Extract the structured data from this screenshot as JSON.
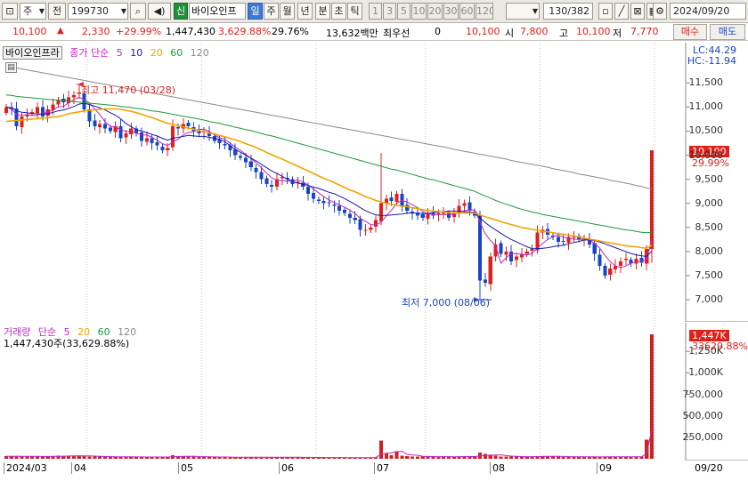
{
  "toolbar": {
    "market_label": "주",
    "prev_label": "전",
    "code_value": "199730",
    "new_badge": "신",
    "stock_name": "바이오인프",
    "periods": [
      "일",
      "주",
      "월",
      "년",
      "분",
      "초",
      "틱"
    ],
    "minute_options": [
      "1",
      "3",
      "5",
      "10",
      "20",
      "30",
      "60",
      "120"
    ],
    "count_value": "130/382",
    "date_value": "2024/09/20"
  },
  "quote": {
    "price": "10,100",
    "change": "2,330",
    "change_pct": "+29.99%",
    "volume": "1,447,430",
    "volume_ratio": "3,629.88%",
    "turnover": "29.76%",
    "amount": "13,632백만",
    "priority_label": "최우선",
    "priority_value": "0",
    "priority_price": "10,100",
    "open_label": "시",
    "open": "7,800",
    "high_label": "고",
    "high": "10,100",
    "low_label": "저",
    "low": "7,770",
    "buy_label": "매수",
    "sell_label": "매도"
  },
  "price_pane": {
    "name_label": "바이오인프라",
    "ma_title": "종가 단순",
    "ma_periods": [
      "5",
      "10",
      "20",
      "60",
      "120"
    ],
    "lc_label": "LC:44.29",
    "hc_label": "HC:-11.94",
    "high_note": "최고 11,470 (03/28)",
    "low_note": "최저 7,000 (08/06)",
    "last_price_tag": "10,100",
    "last_pct_tag": "29.99%"
  },
  "volume_pane": {
    "title": "거래량",
    "ma_title": "단순",
    "ma_periods": [
      "5",
      "20",
      "60",
      "120"
    ],
    "value_label": "1,447,430주(33,629.88%)",
    "last_tag": "1,447K",
    "last_pct_tag": "33629.88%"
  },
  "colors": {
    "up": "#e0201b",
    "down": "#1646c8",
    "ma5": "#c026c0",
    "ma10": "#1a1aa8",
    "ma20": "#f0a500",
    "ma60": "#1a9a3a",
    "ma120": "#8a8a8a",
    "volume": "#d02020"
  },
  "chart_data": [
    {
      "type": "candlestick",
      "title": "바이오인프라",
      "yaxis_ticks": [
        7000,
        7500,
        8000,
        8500,
        9000,
        9500,
        10000,
        10500,
        11000,
        11500
      ],
      "ylim": [
        6800,
        12150
      ],
      "xaxis_ticks": [
        "2024/03",
        "04",
        "05",
        "06",
        "07",
        "08",
        "09",
        "09/20"
      ],
      "series": [
        {
          "name": "close",
          "values": [
            11000,
            10950,
            10600,
            10800,
            10850,
            10900,
            11000,
            10800,
            10950,
            11050,
            11150,
            11100,
            11200,
            11250,
            11300,
            10950,
            10700,
            10600,
            10650,
            10550,
            10500,
            10600,
            10350,
            10450,
            10550,
            10450,
            10300,
            10350,
            10250,
            10200,
            10100,
            10150,
            10600,
            10550,
            10650,
            10600,
            10500,
            10450,
            10500,
            10400,
            10300,
            10250,
            10200,
            10100,
            10000,
            9950,
            9850,
            9750,
            9650,
            9500,
            9400,
            9350,
            9500,
            9550,
            9500,
            9400,
            9450,
            9350,
            9200,
            9100,
            9050,
            9000,
            9000,
            8950,
            8850,
            8800,
            8700,
            8650,
            8450,
            8450,
            8500,
            8650,
            9000,
            9100,
            9050,
            9200,
            8950,
            8850,
            8800,
            8750,
            8700,
            8800,
            8750,
            8800,
            8800,
            8700,
            8800,
            8950,
            9000,
            8850,
            8750,
            7400,
            7350,
            7900,
            8150,
            7950,
            8000,
            7800,
            7900,
            7950,
            8000,
            8050,
            8400,
            8450,
            8350,
            8300,
            8200,
            8200,
            8300,
            8300,
            8250,
            8250,
            8150,
            7950,
            7700,
            7500,
            7650,
            7700,
            7800,
            7850,
            7750,
            7850,
            7770,
            8050,
            10100
          ]
        },
        {
          "name": "5",
          "values": [
            11000,
            10960,
            10840,
            10830,
            10840,
            10820,
            10830,
            10870,
            10890,
            10940,
            11000,
            11010,
            11090,
            11150,
            11200,
            11160,
            11080,
            10960,
            10840,
            10690,
            10600,
            10580,
            10530,
            10490,
            10490,
            10460,
            10420,
            10420,
            10370,
            10310,
            10240,
            10200,
            10270,
            10330,
            10420,
            10470,
            10490,
            10530,
            10540,
            10490,
            10420,
            10360,
            10330,
            10250,
            10170,
            10100,
            10020,
            9930,
            9840,
            9740,
            9630,
            9530,
            9480,
            9470,
            9460,
            9470,
            9480,
            9450,
            9380,
            9300,
            9220,
            9140,
            9070,
            9020,
            8970,
            8920,
            8860,
            8790,
            8690,
            8630,
            8560,
            8550,
            8610,
            8740,
            8860,
            9000,
            9060,
            9030,
            8970,
            8910,
            8830,
            8780,
            8770,
            8770,
            8770,
            8770,
            8770,
            8810,
            8850,
            8860,
            8860,
            8610,
            8370,
            8230,
            8120,
            7760,
            7870,
            7960,
            7960,
            7940,
            7930,
            7960,
            8070,
            8170,
            8250,
            8310,
            8340,
            8300,
            8270,
            8260,
            8250,
            8260,
            8240,
            8170,
            8070,
            7920,
            7790,
            7700,
            7670,
            7700,
            7760,
            7790,
            7790,
            7840,
            8260
          ]
        },
        {
          "name": "10",
          "values": [
            11000,
            10980,
            10920,
            10890,
            10880,
            10860,
            10860,
            10850,
            10860,
            10890,
            10920,
            10940,
            10970,
            11010,
            11060,
            11080,
            11050,
            11020,
            10980,
            10940,
            10880,
            10830,
            10750,
            10660,
            10590,
            10530,
            10500,
            10470,
            10430,
            10400,
            10350,
            10310,
            10350,
            10370,
            10390,
            10410,
            10400,
            10390,
            10390,
            10370,
            10350,
            10330,
            10280,
            10200,
            10120,
            10060,
            10000,
            9940,
            9880,
            9810,
            9740,
            9670,
            9620,
            9560,
            9500,
            9450,
            9420,
            9400,
            9370,
            9340,
            9310,
            9270,
            9230,
            9200,
            9150,
            9100,
            9040,
            8980,
            8910,
            8850,
            8800,
            8760,
            8750,
            8750,
            8760,
            8770,
            8780,
            8800,
            8800,
            8800,
            8790,
            8790,
            8810,
            8820,
            8830,
            8840,
            8840,
            8840,
            8830,
            8820,
            8810,
            8700,
            8600,
            8520,
            8450,
            8380,
            8310,
            8250,
            8200,
            8150,
            8100,
            8060,
            8060,
            8070,
            8080,
            8100,
            8120,
            8130,
            8160,
            8190,
            8210,
            8240,
            8240,
            8230,
            8200,
            8160,
            8120,
            8080,
            8040,
            8000,
            7960,
            7930,
            7910,
            7900,
            8010
          ]
        },
        {
          "name": "20",
          "values": [
            10700,
            10710,
            10720,
            10730,
            10740,
            10750,
            10760,
            10770,
            10780,
            10790,
            10800,
            10830,
            10860,
            10880,
            10900,
            10920,
            10930,
            10940,
            10950,
            10960,
            10960,
            10960,
            10950,
            10930,
            10910,
            10880,
            10850,
            10810,
            10780,
            10740,
            10700,
            10660,
            10640,
            10610,
            10590,
            10560,
            10540,
            10510,
            10490,
            10460,
            10440,
            10410,
            10380,
            10350,
            10320,
            10280,
            10240,
            10200,
            10160,
            10110,
            10060,
            10010,
            9960,
            9920,
            9870,
            9820,
            9770,
            9720,
            9670,
            9620,
            9570,
            9520,
            9480,
            9430,
            9380,
            9330,
            9280,
            9240,
            9190,
            9140,
            9100,
            9060,
            9030,
            9000,
            8980,
            8960,
            8940,
            8930,
            8910,
            8890,
            8870,
            8850,
            8840,
            8830,
            8820,
            8810,
            8800,
            8800,
            8800,
            8800,
            8800,
            8760,
            8720,
            8690,
            8660,
            8620,
            8590,
            8560,
            8530,
            8500,
            8480,
            8460,
            8440,
            8420,
            8410,
            8390,
            8370,
            8360,
            8340,
            8320,
            8300,
            8280,
            8260,
            8240,
            8220,
            8200,
            8180,
            8160,
            8140,
            8120,
            8110,
            8100,
            8080,
            8070,
            8130
          ]
        },
        {
          "name": "60",
          "values": [
            11250,
            11240,
            11220,
            11210,
            11200,
            11190,
            11180,
            11170,
            11160,
            11150,
            11140,
            11130,
            11120,
            11110,
            11100,
            11090,
            11080,
            11070,
            11060,
            11050,
            11040,
            11030,
            11010,
            11000,
            10990,
            10970,
            10960,
            10940,
            10920,
            10910,
            10890,
            10870,
            10850,
            10830,
            10810,
            10790,
            10770,
            10750,
            10730,
            10700,
            10680,
            10660,
            10630,
            10610,
            10580,
            10560,
            10530,
            10510,
            10480,
            10450,
            10420,
            10400,
            10370,
            10340,
            10310,
            10280,
            10250,
            10220,
            10190,
            10160,
            10130,
            10100,
            10070,
            10040,
            10010,
            9980,
            9950,
            9920,
            9890,
            9860,
            9830,
            9800,
            9770,
            9740,
            9710,
            9690,
            9660,
            9630,
            9600,
            9570,
            9540,
            9510,
            9490,
            9460,
            9430,
            9400,
            9370,
            9340,
            9310,
            9280,
            9250,
            9200,
            9150,
            9110,
            9060,
            9020,
            8980,
            8950,
            8910,
            8880,
            8850,
            8820,
            8800,
            8770,
            8750,
            8730,
            8710,
            8690,
            8670,
            8650,
            8630,
            8610,
            8590,
            8570,
            8550,
            8530,
            8510,
            8490,
            8470,
            8450,
            8440,
            8420,
            8400,
            8390,
            8400
          ]
        },
        {
          "name": "120",
          "values": [
            11850,
            11830,
            11810,
            11790,
            11770,
            11750,
            11730,
            11710,
            11690,
            11670,
            11650,
            11630,
            11610,
            11590,
            11570,
            11550,
            11530,
            11510,
            11490,
            11470,
            11450,
            11430,
            11410,
            11390,
            11370,
            11350,
            11330,
            11310,
            11290,
            11270,
            11250,
            11230,
            11210,
            11190,
            11170,
            11150,
            11130,
            11110,
            11090,
            11070,
            11050,
            11030,
            11010,
            10990,
            10970,
            10950,
            10930,
            10910,
            10890,
            10870,
            10850,
            10830,
            10810,
            10790,
            10770,
            10750,
            10730,
            10710,
            10690,
            10670,
            10650,
            10630,
            10610,
            10590,
            10570,
            10550,
            10530,
            10510,
            10490,
            10470,
            10450,
            10430,
            10410,
            10390,
            10370,
            10350,
            10330,
            10310,
            10290,
            10270,
            10250,
            10230,
            10210,
            10190,
            10170,
            10150,
            10120,
            10100,
            10080,
            10060,
            10040,
            10020,
            10000,
            9980,
            9960,
            9940,
            9920,
            9890,
            9870,
            9850,
            9830,
            9810,
            9790,
            9770,
            9750,
            9720,
            9700,
            9680,
            9660,
            9640,
            9610,
            9590,
            9570,
            9550,
            9530,
            9510,
            9480,
            9460,
            9440,
            9420,
            9400,
            9370,
            9350,
            9320,
            9300
          ]
        }
      ]
    },
    {
      "type": "bar",
      "title": "거래량",
      "yaxis_ticks": [
        "250,000",
        "500,000",
        "750,000",
        "1,000K",
        "1,250K"
      ],
      "ylim": [
        0,
        1500000
      ],
      "values": [
        30000,
        28000,
        32000,
        26000,
        24000,
        30000,
        28000,
        26000,
        25000,
        30000,
        35000,
        32000,
        38000,
        36000,
        34000,
        30000,
        28000,
        26000,
        25000,
        24000,
        23000,
        22000,
        24000,
        22000,
        21000,
        20000,
        22000,
        21000,
        20000,
        19000,
        20000,
        22000,
        40000,
        30000,
        28000,
        26000,
        24000,
        23000,
        22000,
        21000,
        20000,
        19000,
        19000,
        18000,
        18000,
        19000,
        20000,
        19000,
        18000,
        18000,
        17000,
        17000,
        18000,
        18000,
        17000,
        16000,
        17000,
        16000,
        16000,
        15000,
        15000,
        15000,
        14000,
        14000,
        14000,
        13000,
        13000,
        13000,
        14000,
        14000,
        15000,
        16000,
        210000,
        60000,
        40000,
        90000,
        35000,
        30000,
        28000,
        26000,
        25000,
        26000,
        24000,
        25000,
        24000,
        23000,
        24000,
        26000,
        30000,
        25000,
        24000,
        70000,
        55000,
        40000,
        35000,
        28000,
        27000,
        25000,
        24000,
        24000,
        25000,
        26000,
        30000,
        32000,
        28000,
        26000,
        24000,
        23000,
        24000,
        24000,
        23000,
        22000,
        22000,
        22000,
        22000,
        25000,
        23000,
        22000,
        24000,
        23000,
        22000,
        23000,
        24000,
        220000,
        1447430
      ]
    }
  ]
}
